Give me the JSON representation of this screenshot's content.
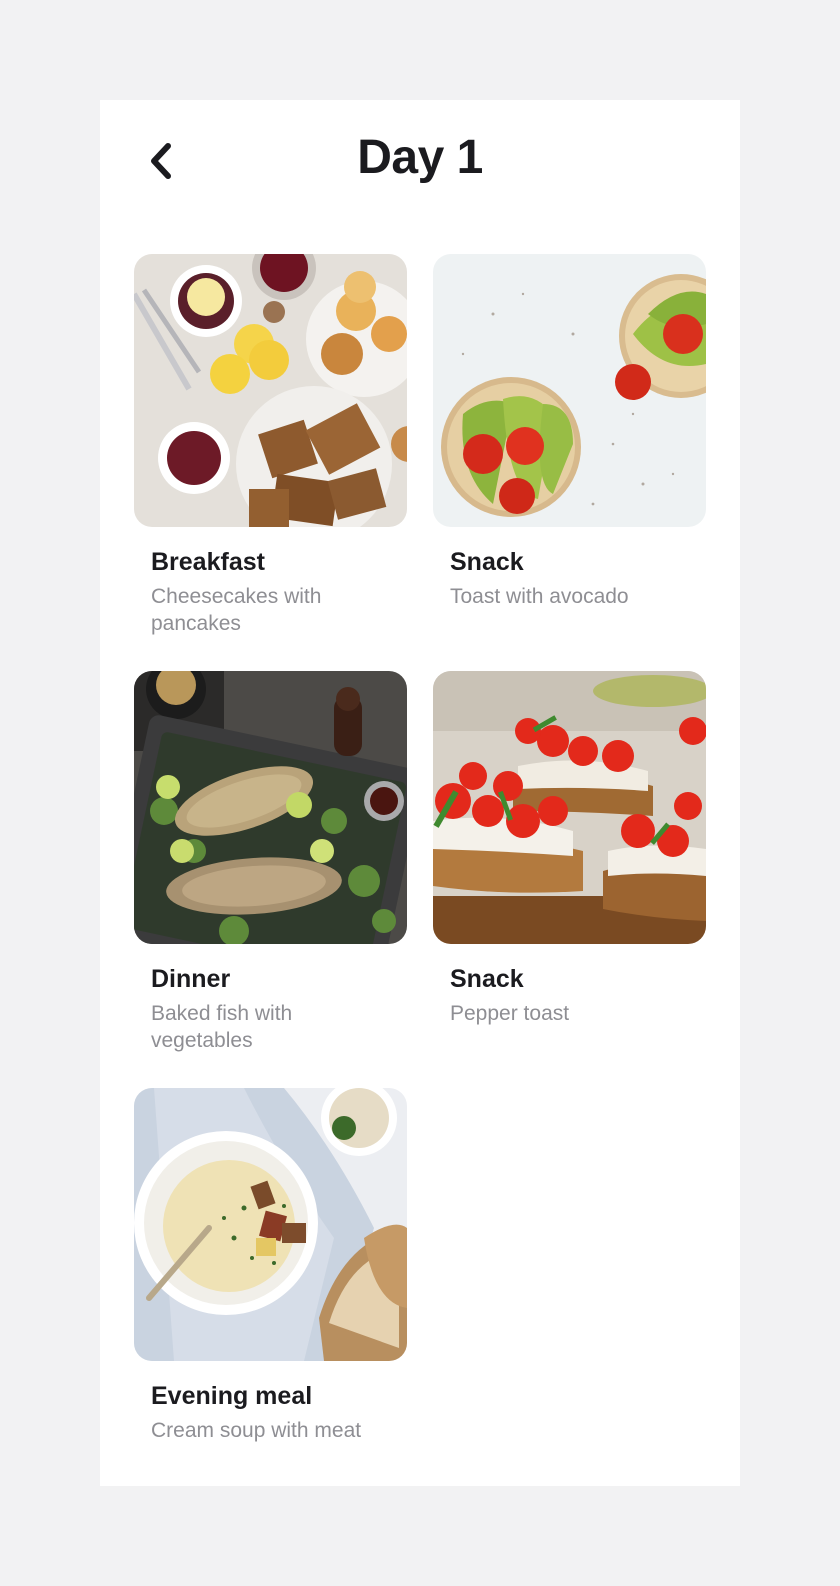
{
  "header": {
    "title": "Day 1",
    "back_icon": "chevron-left-icon"
  },
  "meals": [
    {
      "name": "Breakfast",
      "description": "Cheesecakes with pancakes",
      "image": "breakfast-photo"
    },
    {
      "name": "Snack",
      "description": "Toast with avocado",
      "image": "avocado-toast-photo"
    },
    {
      "name": "Dinner",
      "description": "Baked fish with vegetables",
      "image": "baked-fish-photo"
    },
    {
      "name": "Snack",
      "description": "Pepper toast",
      "image": "pepper-toast-photo"
    },
    {
      "name": "Evening meal",
      "description": "Cream soup with meat",
      "image": "cream-soup-photo"
    }
  ],
  "colors": {
    "page_background": "#f2f2f3",
    "card_background": "#ffffff",
    "title_text": "#1b1b1f",
    "secondary_text": "#8e8e93"
  }
}
